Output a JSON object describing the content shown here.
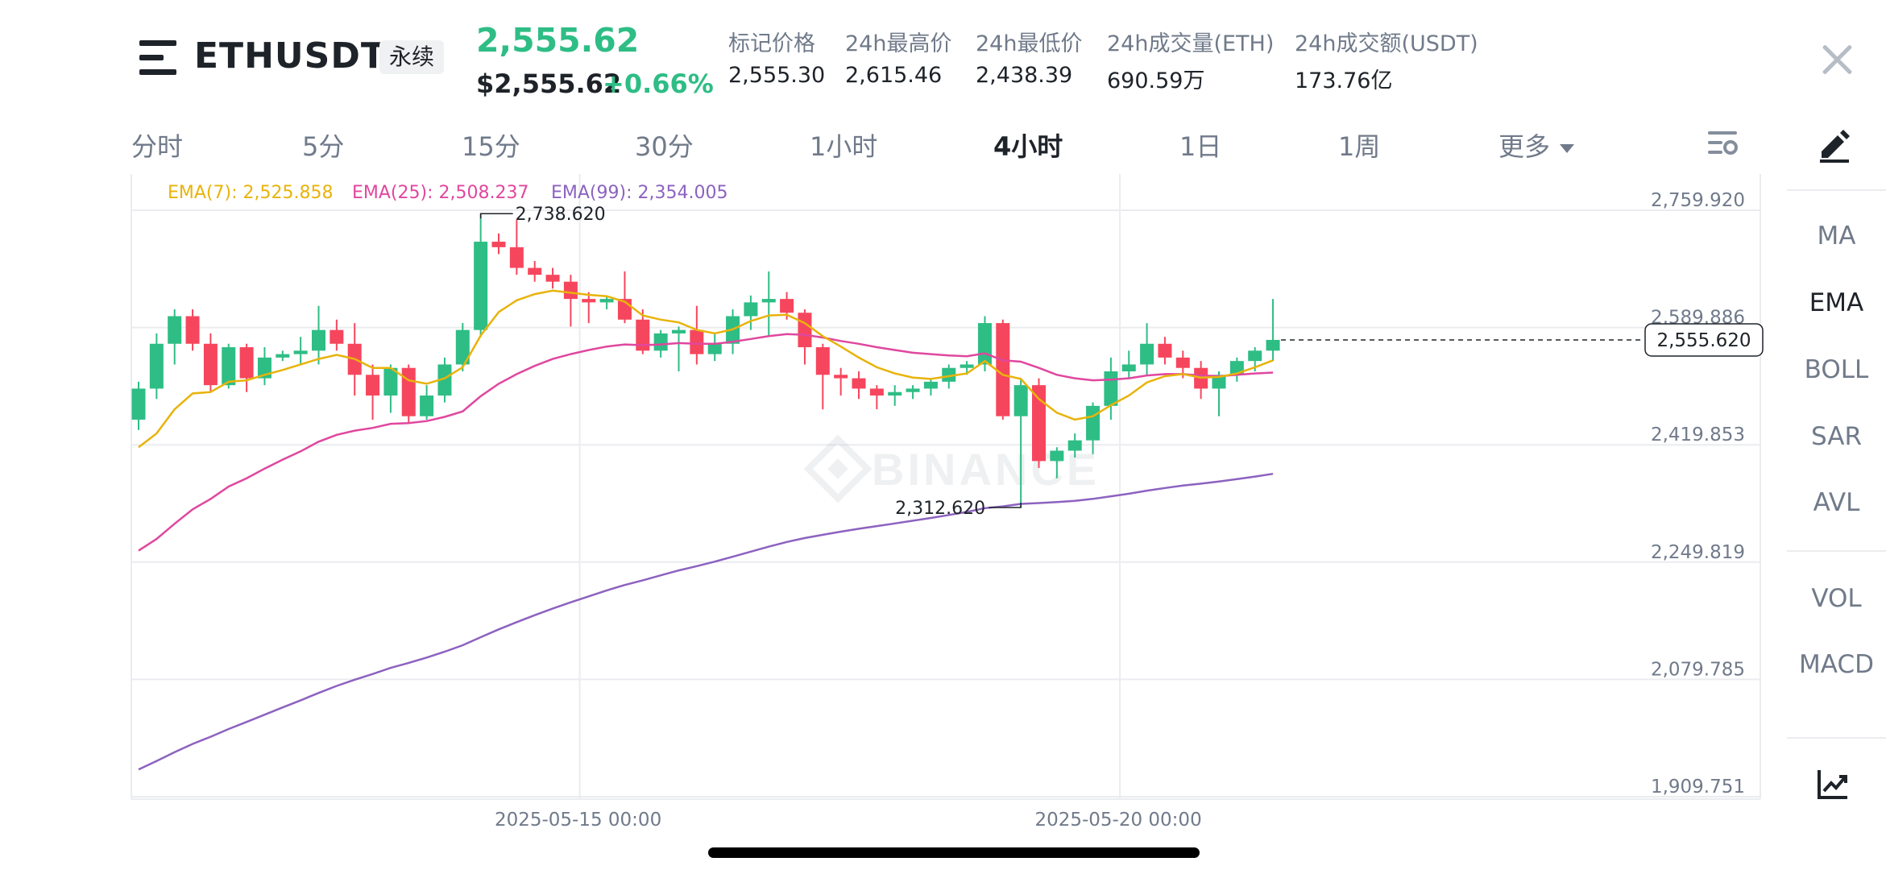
{
  "header": {
    "symbol": "ETHUSDT",
    "contract_type": "永续",
    "last_price": "2,555.62",
    "usd_price": "$2,555.62",
    "change_percent": "+0.66%",
    "stats": [
      {
        "label": "标记价格",
        "value": "2,555.30"
      },
      {
        "label": "24h最高价",
        "value": "2,615.46"
      },
      {
        "label": "24h最低价",
        "value": "2,438.39"
      },
      {
        "label": "24h成交量(ETH)",
        "value": "690.59万"
      },
      {
        "label": "24h成交额(USDT)",
        "value": "173.76亿"
      }
    ]
  },
  "tabs": [
    "分时",
    "5分",
    "15分",
    "30分",
    "1小时",
    "4小时",
    "1日",
    "1周",
    "更多"
  ],
  "active_tab": "4小时",
  "indicators_panel": {
    "main": [
      "MA",
      "EMA",
      "BOLL",
      "SAR",
      "AVL"
    ],
    "sub": [
      "VOL",
      "MACD"
    ],
    "active": "EMA"
  },
  "colors": {
    "up": "#2ebd85",
    "down": "#f6465d",
    "ema7": "#e8b30b",
    "ema25": "#e0479e",
    "ema99": "#8c62c0",
    "grid": "#eaecef"
  },
  "chart_data": {
    "type": "candlestick",
    "watermark": "BINANCE",
    "legend": [
      {
        "name": "EMA(7)",
        "value": "2,525.858",
        "color": "#e8b30b"
      },
      {
        "name": "EMA(25)",
        "value": "2,508.237",
        "color": "#e0479e"
      },
      {
        "name": "EMA(99)",
        "value": "2,354.005",
        "color": "#8c62c0"
      }
    ],
    "y_ticks": [
      "2,759.920",
      "2,589.886",
      "2,419.853",
      "2,249.819",
      "2,079.785",
      "1,909.751"
    ],
    "ylim": [
      1909.751,
      2759.92
    ],
    "x_ticks": [
      {
        "label": "2025-05-15 00:00",
        "index": 24.5
      },
      {
        "label": "2025-05-20 00:00",
        "index": 54.5
      }
    ],
    "last_price_label": "2,555.620",
    "last_price": 2555.62,
    "high_marker": {
      "label": "2,738.620",
      "value": 2738.62,
      "index": 19
    },
    "low_marker": {
      "label": "2,312.620",
      "value": 2312.62,
      "index": 49
    },
    "candles": [
      [
        2440,
        2485,
        2425,
        2495
      ],
      [
        2485,
        2550,
        2470,
        2565
      ],
      [
        2550,
        2590,
        2520,
        2600
      ],
      [
        2590,
        2550,
        2540,
        2600
      ],
      [
        2550,
        2490,
        2480,
        2565
      ],
      [
        2490,
        2545,
        2485,
        2550
      ],
      [
        2545,
        2500,
        2480,
        2550
      ],
      [
        2500,
        2530,
        2490,
        2545
      ],
      [
        2530,
        2535,
        2525,
        2540
      ],
      [
        2535,
        2540,
        2520,
        2560
      ],
      [
        2540,
        2570,
        2520,
        2605
      ],
      [
        2570,
        2550,
        2540,
        2585
      ],
      [
        2550,
        2505,
        2475,
        2580
      ],
      [
        2505,
        2475,
        2440,
        2520
      ],
      [
        2475,
        2515,
        2450,
        2520
      ],
      [
        2515,
        2445,
        2435,
        2520
      ],
      [
        2445,
        2475,
        2440,
        2490
      ],
      [
        2475,
        2520,
        2465,
        2530
      ],
      [
        2520,
        2570,
        2510,
        2580
      ],
      [
        2570,
        2698,
        2560,
        2738.62
      ],
      [
        2698,
        2690,
        2680,
        2710
      ],
      [
        2690,
        2660,
        2650,
        2730
      ],
      [
        2660,
        2650,
        2640,
        2670
      ],
      [
        2650,
        2640,
        2630,
        2660
      ],
      [
        2640,
        2615,
        2575,
        2650
      ],
      [
        2615,
        2610,
        2580,
        2625
      ],
      [
        2610,
        2615,
        2600,
        2620
      ],
      [
        2615,
        2585,
        2580,
        2655
      ],
      [
        2585,
        2540,
        2535,
        2600
      ],
      [
        2540,
        2565,
        2530,
        2570
      ],
      [
        2565,
        2570,
        2510,
        2575
      ],
      [
        2570,
        2535,
        2520,
        2605
      ],
      [
        2535,
        2550,
        2525,
        2565
      ],
      [
        2550,
        2590,
        2535,
        2600
      ],
      [
        2590,
        2610,
        2570,
        2620
      ],
      [
        2610,
        2615,
        2560,
        2655
      ],
      [
        2615,
        2595,
        2585,
        2625
      ],
      [
        2595,
        2545,
        2520,
        2600
      ],
      [
        2545,
        2505,
        2455,
        2550
      ],
      [
        2505,
        2500,
        2475,
        2515
      ],
      [
        2500,
        2485,
        2470,
        2510
      ],
      [
        2485,
        2475,
        2455,
        2490
      ],
      [
        2475,
        2480,
        2460,
        2490
      ],
      [
        2480,
        2485,
        2470,
        2490
      ],
      [
        2485,
        2495,
        2475,
        2500
      ],
      [
        2495,
        2515,
        2485,
        2520
      ],
      [
        2515,
        2520,
        2505,
        2525
      ],
      [
        2520,
        2580,
        2510,
        2590
      ],
      [
        2580,
        2445,
        2440,
        2585
      ],
      [
        2445,
        2490,
        2312.62,
        2500
      ],
      [
        2490,
        2380,
        2370,
        2500
      ],
      [
        2380,
        2395,
        2355,
        2400
      ],
      [
        2395,
        2410,
        2385,
        2420
      ],
      [
        2410,
        2460,
        2390,
        2465
      ],
      [
        2460,
        2510,
        2440,
        2530
      ],
      [
        2510,
        2520,
        2500,
        2540
      ],
      [
        2520,
        2550,
        2505,
        2580
      ],
      [
        2550,
        2530,
        2520,
        2560
      ],
      [
        2530,
        2515,
        2500,
        2540
      ],
      [
        2515,
        2485,
        2470,
        2525
      ],
      [
        2485,
        2505,
        2445,
        2510
      ],
      [
        2505,
        2525,
        2495,
        2530
      ],
      [
        2525,
        2540,
        2510,
        2545
      ],
      [
        2540,
        2555.62,
        2525,
        2615
      ]
    ],
    "ema7": [
      2400,
      2420,
      2455,
      2478,
      2480,
      2495,
      2497,
      2505,
      2512,
      2520,
      2528,
      2534,
      2528,
      2515,
      2515,
      2497,
      2492,
      2500,
      2516,
      2562,
      2596,
      2613,
      2622,
      2627,
      2624,
      2621,
      2619,
      2611,
      2591,
      2585,
      2581,
      2570,
      2565,
      2571,
      2583,
      2591,
      2592,
      2580,
      2561,
      2546,
      2530,
      2516,
      2507,
      2501,
      2499,
      2503,
      2507,
      2525,
      2505,
      2499,
      2470,
      2450,
      2440,
      2445,
      2461,
      2475,
      2494,
      2503,
      2506,
      2501,
      2502,
      2507,
      2516,
      2526
    ],
    "ema25": [
      2250,
      2267,
      2289,
      2310,
      2325,
      2343,
      2355,
      2369,
      2382,
      2394,
      2408,
      2418,
      2424,
      2428,
      2434,
      2435,
      2438,
      2444,
      2452,
      2474,
      2492,
      2506,
      2518,
      2528,
      2535,
      2541,
      2546,
      2549,
      2548,
      2549,
      2551,
      2550,
      2550,
      2553,
      2557,
      2561,
      2564,
      2563,
      2559,
      2554,
      2550,
      2545,
      2541,
      2537,
      2535,
      2533,
      2532,
      2536,
      2526,
      2524,
      2515,
      2505,
      2500,
      2497,
      2498,
      2500,
      2504,
      2506,
      2506,
      2504,
      2503,
      2505,
      2507,
      2508.237
    ]
  }
}
